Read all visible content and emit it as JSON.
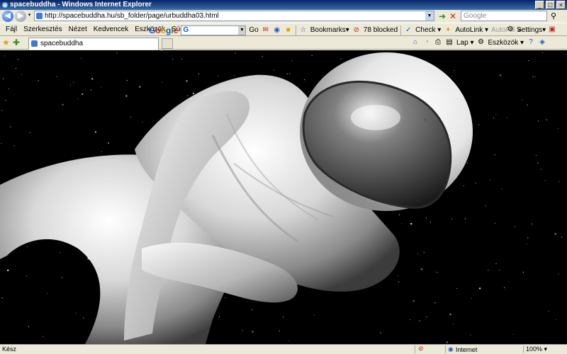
{
  "window": {
    "title": "spacebuddha - Windows Internet Explorer"
  },
  "address": {
    "url": "http://spacebuddha.hu/sb_folder/page/urbuddha03.html"
  },
  "search": {
    "placeholder": "Google"
  },
  "menu": {
    "items": [
      "Fájl",
      "Szerkesztés",
      "Nézet",
      "Kedvencek",
      "Eszközök",
      "Súgó"
    ]
  },
  "google_toolbar": {
    "go_label": "Go",
    "bookmarks_label": "Bookmarks▾",
    "blocked_label": "78 blocked",
    "check_label": "Check ▾",
    "autolink_label": "AutoLink ▾",
    "autofill_label": "AutoFill",
    "more_label": "»",
    "settings_label": "Settings▾"
  },
  "tab": {
    "title": "spacebuddha"
  },
  "command_bar": {
    "page_label": "Lap ▾",
    "tools_label": "Eszközök ▾"
  },
  "status": {
    "text": "Kész",
    "zone": "Internet",
    "zoom": "100% ▾"
  },
  "colors": {
    "titlebar": "#0a246a",
    "content_bg": "#000000",
    "chrome": "#ece9d8"
  },
  "icons": [
    "ie-logo-icon",
    "back-icon",
    "forward-icon",
    "refresh-icon",
    "stop-icon",
    "search-icon",
    "star-icon",
    "popup-block-icon",
    "spellcheck-icon",
    "wand-icon",
    "gear-icon",
    "home-icon",
    "feeds-icon",
    "print-icon",
    "help-icon",
    "globe-icon"
  ]
}
